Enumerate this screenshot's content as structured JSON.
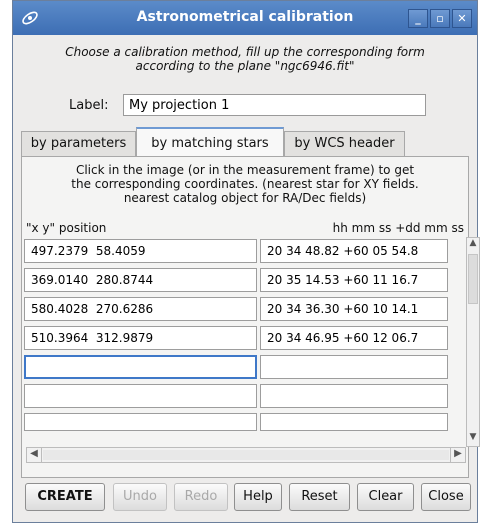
{
  "window": {
    "title": "Astronometrical calibration",
    "icon": "aladin-logo-icon",
    "controls": {
      "minimize": "_",
      "maximize": "▫",
      "close": "✕"
    }
  },
  "intro": {
    "line1": "Choose a calibration method, fill up the corresponding form",
    "line2": "according to the plane \"ngc6946.fit\""
  },
  "label": {
    "text": "Label:",
    "value": "My projection 1"
  },
  "tabs": [
    {
      "label": "by parameters",
      "selected": false
    },
    {
      "label": "by matching stars",
      "selected": true
    },
    {
      "label": "by WCS header",
      "selected": false
    }
  ],
  "panel": {
    "instructions": {
      "line1": "Click in the image (or in the measurement frame) to get",
      "line2": "the corresponding coordinates. (nearest star for XY fields.",
      "line3": "nearest catalog object for RA/Dec fields)"
    },
    "col_xy": "\"x y\" position",
    "col_radec": "hh mm ss +dd mm ss",
    "rows": [
      {
        "xy": "497.2379  58.4059",
        "radec": "20 34 48.82 +60 05 54.8"
      },
      {
        "xy": "369.0140  280.8744",
        "radec": "20 35 14.53 +60 11 16.7"
      },
      {
        "xy": "580.4028  270.6286",
        "radec": "20 34 36.30 +60 10 14.1"
      },
      {
        "xy": "510.3964  312.9879",
        "radec": "20 34 46.95 +60 12 06.7"
      },
      {
        "xy": "",
        "radec": ""
      },
      {
        "xy": "",
        "radec": ""
      },
      {
        "xy": "",
        "radec": ""
      }
    ]
  },
  "buttons": {
    "create": "CREATE",
    "undo": "Undo",
    "redo": "Redo",
    "help": "Help",
    "reset": "Reset",
    "clear": "Clear",
    "close": "Close"
  },
  "colors": {
    "titlebar": "#4a7cc0",
    "accent": "#3f78c8"
  }
}
